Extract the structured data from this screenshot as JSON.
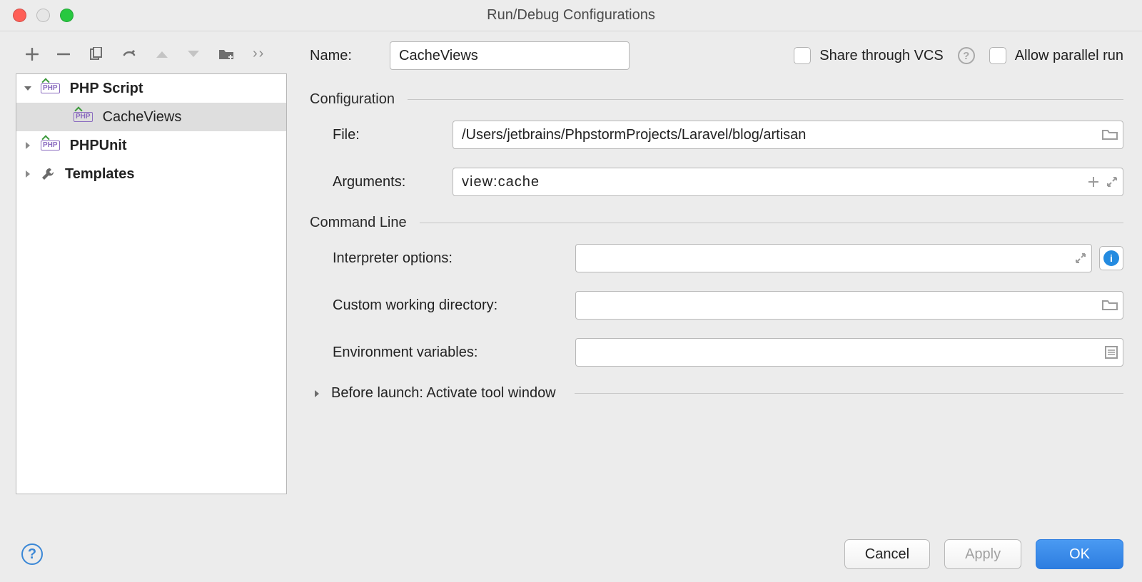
{
  "window": {
    "title": "Run/Debug Configurations"
  },
  "tree": {
    "items": [
      {
        "label": "PHP Script",
        "expanded": true,
        "icon": "php",
        "bold": true
      },
      {
        "label": "CacheViews",
        "child": true,
        "icon": "php",
        "selected": true
      },
      {
        "label": "PHPUnit",
        "expanded": false,
        "icon": "php",
        "bold": true
      },
      {
        "label": "Templates",
        "expanded": false,
        "icon": "wrench",
        "bold": true
      }
    ]
  },
  "form": {
    "name_label": "Name:",
    "name_value": "CacheViews",
    "share_label": "Share through VCS",
    "parallel_label": "Allow parallel run",
    "configuration_header": "Configuration",
    "file_label": "File:",
    "file_value": "/Users/jetbrains/PhpstormProjects/Laravel/blog/artisan",
    "arguments_label": "Arguments:",
    "arguments_value": "view:cache",
    "commandline_header": "Command Line",
    "interpreter_options_label": "Interpreter options:",
    "interpreter_options_value": "",
    "cwd_label": "Custom working directory:",
    "cwd_value": "",
    "env_label": "Environment variables:",
    "env_value": "",
    "before_launch": "Before launch: Activate tool window"
  },
  "buttons": {
    "cancel": "Cancel",
    "apply": "Apply",
    "ok": "OK"
  }
}
